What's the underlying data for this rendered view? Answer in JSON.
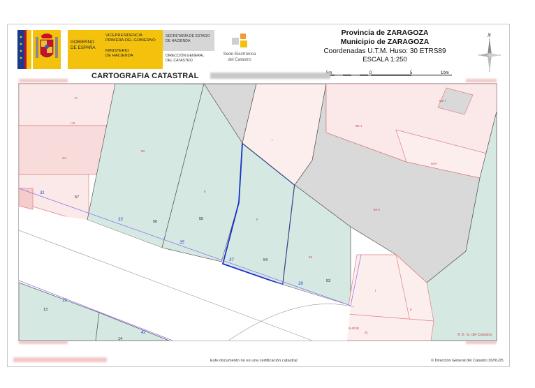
{
  "header": {
    "gobierno": [
      "GOBIERNO",
      "DE ESPAÑA"
    ],
    "vice_1": [
      "VICEPRESIDENCIA",
      "PRIMERA DEL GOBIERNO"
    ],
    "vice_2": [
      "MINISTERIO",
      "DE HACIENDA"
    ],
    "secr_1": [
      "SECRETARÍA DE ESTADO",
      "DE HACIENDA"
    ],
    "secr_2": [
      "DIRECCIÓN GENERAL",
      "DEL CATASTRO"
    ],
    "sede": [
      "Sede Electrónica",
      "del Catastro"
    ],
    "province": "Provincia de ZARAGOZA",
    "municipality": "Municipio de ZARAGOZA",
    "coords": "Coordenadas U.T.M. Huso: 30 ETRS89",
    "scale_label": "ESCALA 1:250",
    "scale_ticks": [
      "5m",
      "0",
      "5",
      "10m"
    ],
    "north": "N",
    "title": "CARTOGRAFIA CATASTRAL"
  },
  "map": {
    "labels": {
      "n57": "57",
      "n56": "56",
      "n55": "55",
      "n54": "54",
      "n53": "53",
      "n13": "13",
      "n14": "14",
      "h33": "33",
      "h35": "35",
      "h37": "37",
      "h39": "39",
      "h31": "31",
      "h12": "12",
      "h42": "42",
      "c1": "I",
      "c2": "I",
      "c3": "II",
      "c4": "I",
      "rBig": "94+I",
      "rRight": "03+I",
      "rTop": "95+I",
      "rTop2": "03+I",
      "r1": "3+I",
      "r2": "I+II",
      "r3": "III",
      "g1": "5II",
      "g2": "II",
      "g3": "II",
      "g4": "5II",
      "b1": "3+POR",
      "b2": "31"
    },
    "copyright": "© D. G. del Catastro"
  },
  "footer": {
    "note": "Este documento no es una certificación catastral",
    "copy": "© Dirección General del Catastro 30/01/25"
  }
}
